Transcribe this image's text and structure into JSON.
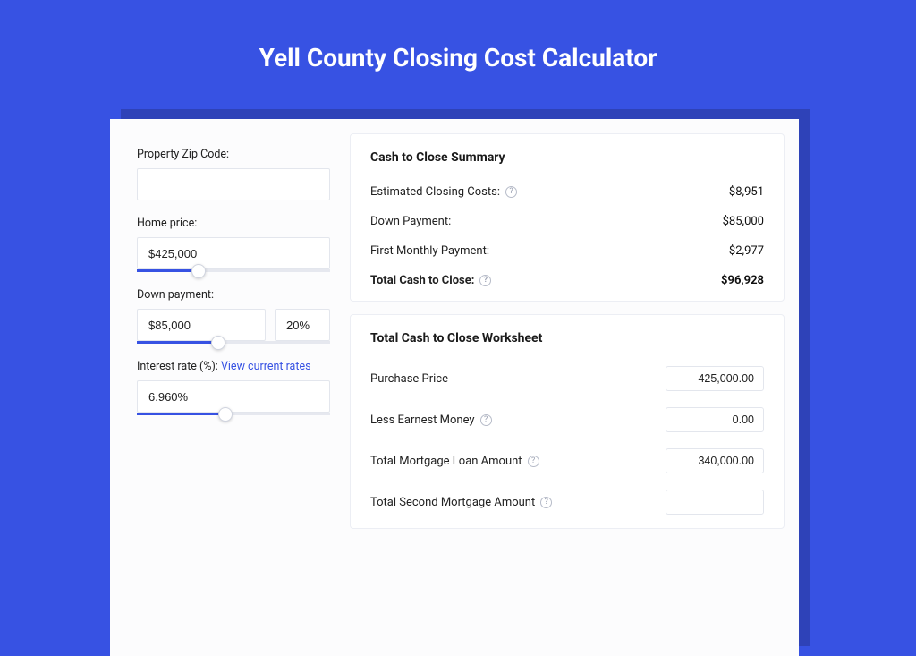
{
  "title": "Yell County Closing Cost Calculator",
  "left": {
    "zip_label": "Property Zip Code:",
    "zip_value": "",
    "home_price_label": "Home price:",
    "home_price_value": "$425,000",
    "home_price_slider_pct": 32,
    "down_payment_label": "Down payment:",
    "down_payment_value": "$85,000",
    "down_payment_pct_value": "20%",
    "down_payment_slider_pct": 42,
    "interest_label_prefix": "Interest rate (%): ",
    "interest_link": "View current rates",
    "interest_value": "6.960%",
    "interest_slider_pct": 46
  },
  "summary": {
    "title": "Cash to Close Summary",
    "rows": [
      {
        "label": "Estimated Closing Costs:",
        "help": true,
        "value": "$8,951"
      },
      {
        "label": "Down Payment:",
        "help": false,
        "value": "$85,000"
      },
      {
        "label": "First Monthly Payment:",
        "help": false,
        "value": "$2,977"
      }
    ],
    "total_label": "Total Cash to Close:",
    "total_value": "$96,928"
  },
  "worksheet": {
    "title": "Total Cash to Close Worksheet",
    "rows": [
      {
        "label": "Purchase Price",
        "help": false,
        "value": "425,000.00"
      },
      {
        "label": "Less Earnest Money",
        "help": true,
        "value": "0.00"
      },
      {
        "label": "Total Mortgage Loan Amount",
        "help": true,
        "value": "340,000.00"
      },
      {
        "label": "Total Second Mortgage Amount",
        "help": true,
        "value": ""
      }
    ]
  }
}
